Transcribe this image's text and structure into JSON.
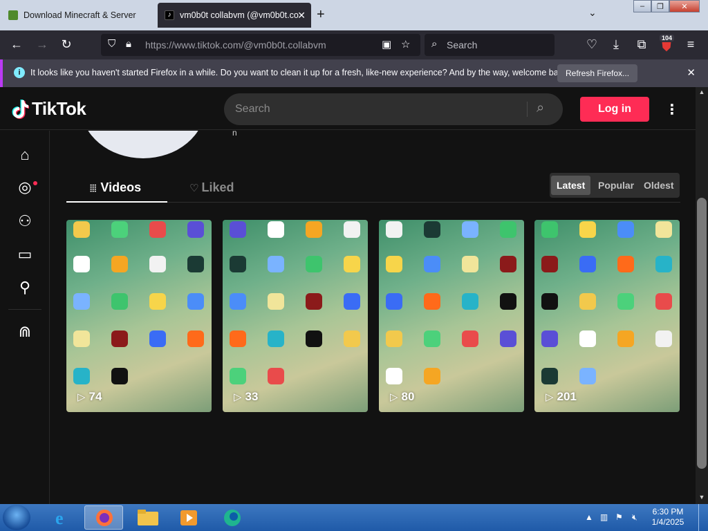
{
  "browser": {
    "tabs": [
      {
        "title": "Download Minecraft & Server",
        "active": false,
        "favicon": "minecraft-icon"
      },
      {
        "title": "vm0b0t collabvm (@vm0b0t.co",
        "active": true,
        "favicon": "tiktok-icon"
      }
    ],
    "url": "https://www.tiktok.com/@vm0b0t.collabvm",
    "search_placeholder": "Search",
    "extension_badge": "104",
    "notification": {
      "message": "It looks like you haven't started Firefox in a while. Do you want to clean it up for a fresh, like-new experience? And by the way, welcome back!",
      "button": "Refresh Firefox..."
    }
  },
  "tiktok": {
    "logo_text": "TikTok",
    "search_placeholder": "Search",
    "login_label": "Log in",
    "avatar_caption": "n",
    "profile_tabs": [
      {
        "label": "Videos",
        "active": true
      },
      {
        "label": "Liked",
        "active": false
      }
    ],
    "sort_options": [
      {
        "label": "Latest",
        "active": true
      },
      {
        "label": "Popular",
        "active": false
      },
      {
        "label": "Oldest",
        "active": false
      }
    ],
    "videos": [
      {
        "views": "74"
      },
      {
        "views": "33"
      },
      {
        "views": "80"
      },
      {
        "views": "201"
      }
    ],
    "brand_color": "#fe2c55"
  },
  "taskbar": {
    "time": "6:30 PM",
    "date": "1/4/2025"
  }
}
